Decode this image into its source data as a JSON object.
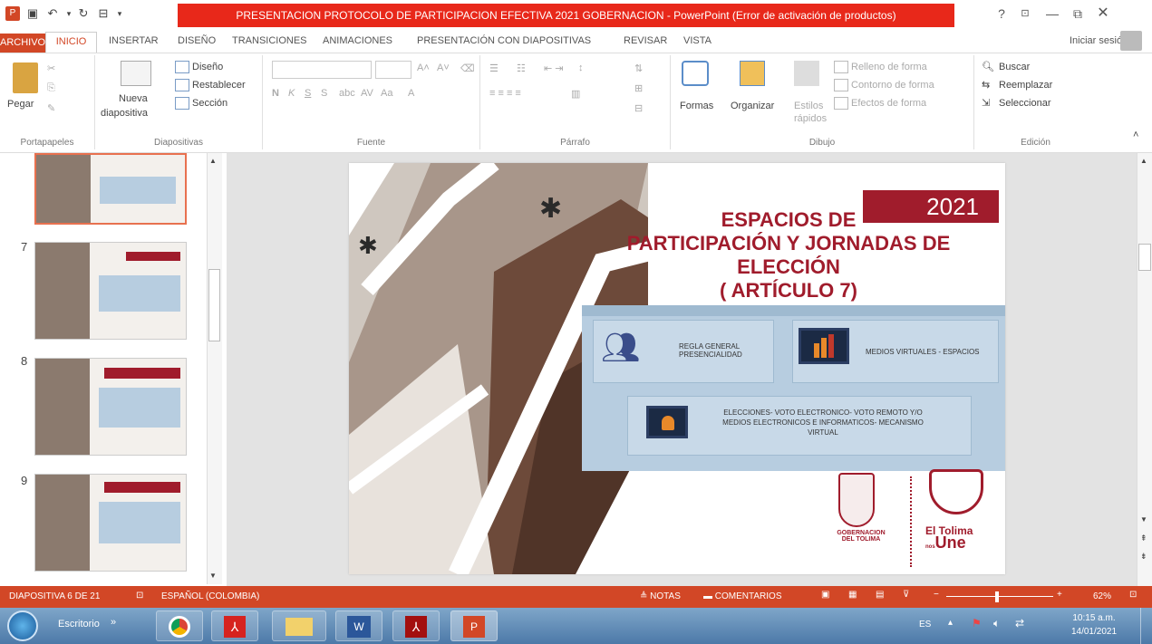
{
  "window": {
    "title": "PRESENTACION PROTOCOLO DE PARTICIPACION EFECTIVA 2021 GOBERNACION - PowerPoint (Error de activación de productos)",
    "help": "?",
    "signin": "Iniciar sesión"
  },
  "tabs": [
    "ARCHIVO",
    "INICIO",
    "INSERTAR",
    "DISEÑO",
    "TRANSICIONES",
    "ANIMACIONES",
    "PRESENTACIÓN CON DIAPOSITIVAS",
    "REVISAR",
    "VISTA"
  ],
  "ribbon": {
    "portapapeles": {
      "label": "Portapapeles",
      "pegar": "Pegar"
    },
    "diapositivas": {
      "label": "Diapositivas",
      "nueva": "Nueva",
      "nueva2": "diapositiva",
      "diseno": "Diseño",
      "restablecer": "Restablecer",
      "seccion": "Sección"
    },
    "fuente": {
      "label": "Fuente",
      "bold": "N",
      "italic": "K",
      "underline": "S",
      "strike": "S",
      "case": "Aa"
    },
    "parrafo": {
      "label": "Párrafo"
    },
    "dibujo": {
      "label": "Dibujo",
      "formas": "Formas",
      "organizar": "Organizar",
      "estilos": "Estilos",
      "estilos2": "rápidos",
      "relleno": "Relleno de forma",
      "contorno": "Contorno de forma",
      "efectos": "Efectos de forma"
    },
    "edicion": {
      "label": "Edición",
      "buscar": "Buscar",
      "reemplazar": "Reemplazar",
      "seleccionar": "Seleccionar"
    }
  },
  "thumbnails": [
    {
      "num": "",
      "selected": true
    },
    {
      "num": "7",
      "selected": false
    },
    {
      "num": "8",
      "selected": false
    },
    {
      "num": "9",
      "selected": false
    }
  ],
  "slide": {
    "year": "2021",
    "title_lines": [
      "ESPACIOS  DE",
      "PARTICIPACIÓN Y JORNADAS DE",
      "ELECCIÓN",
      "( ARTÍCULO 7)"
    ],
    "box1": "REGLA GENERAL PRESENCIALIDAD",
    "box2": "MEDIOS VIRTUALES - ESPACIOS",
    "box3": "ELECCIONES- VOTO ELECTRONICO- VOTO REMOTO Y/O MEDIOS ELECTRONICOS E INFORMATICOS- MECANISMO VIRTUAL",
    "gob1": "GOBERNACION",
    "gob2": "DEL TOLIMA",
    "tolima1": "El Tolima",
    "tolima2": "nos",
    "tolima3": "Une"
  },
  "status": {
    "slide": "DIAPOSITIVA 6 DE 21",
    "language": "ESPAÑOL (COLOMBIA)",
    "notas": "NOTAS",
    "comentarios": "COMENTARIOS",
    "zoom": "62%"
  },
  "taskbar": {
    "escritorio": "Escritorio",
    "lang": "ES",
    "time": "10:15 a.m.",
    "date": "14/01/2021"
  },
  "colors": {
    "accent": "#d24726",
    "title_red": "#e8281a",
    "slide_red": "#a01c2c",
    "panel_blue": "#b7cde0"
  }
}
